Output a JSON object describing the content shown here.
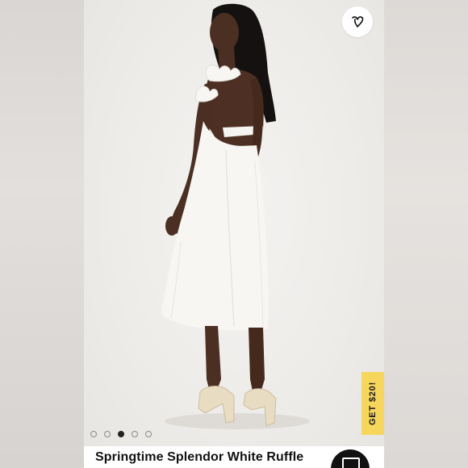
{
  "product": {
    "title": "Springtime Splendor White Ruffle"
  },
  "promo": {
    "label": "GET $20!",
    "color": "#f7d65e"
  },
  "wishlist": {
    "icon": "heart-logo-icon"
  },
  "carousel": {
    "total_slides": 5,
    "active_slide": 3
  },
  "chat": {
    "icon": "chat-icon"
  },
  "colors": {
    "dress": "#f7f6f2",
    "background": "#efedea",
    "title_text": "#111111"
  }
}
